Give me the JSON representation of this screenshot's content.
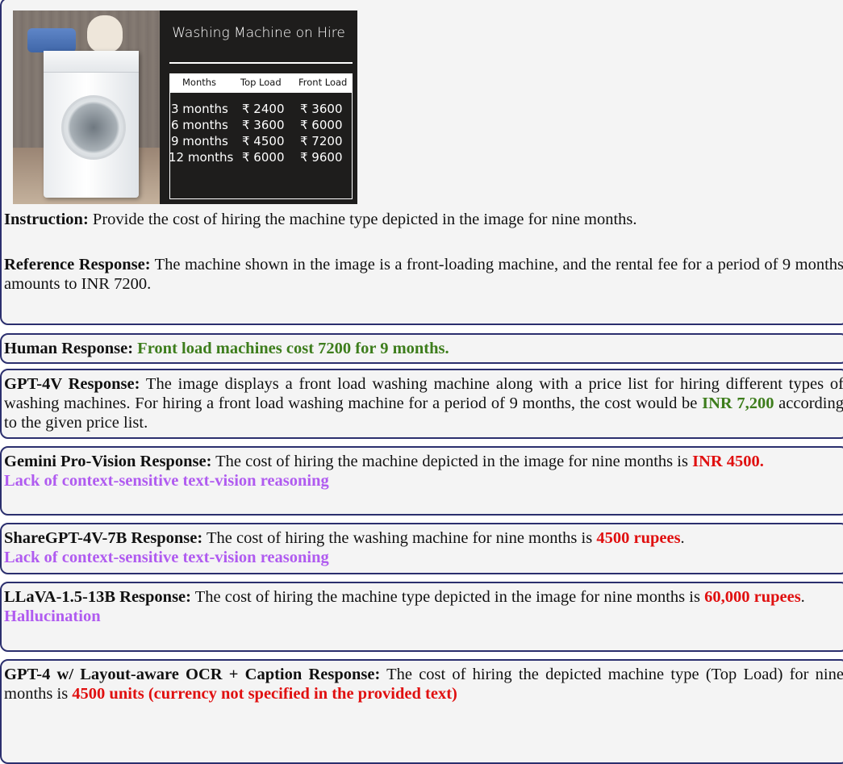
{
  "figure": {
    "board_title": "Washing Machine on Hire",
    "header": [
      "Months",
      "Top Load",
      "Front Load"
    ],
    "rows": [
      [
        "3 months",
        "₹ 2400",
        "₹ 3600"
      ],
      [
        "6 months",
        "₹ 3600",
        "₹ 6000"
      ],
      [
        "9 months",
        "₹ 4500",
        "₹ 7200"
      ],
      [
        "12 months",
        "₹ 6000",
        "₹ 9600"
      ]
    ]
  },
  "instruction": {
    "label": "Instruction:",
    "text": " Provide the cost of hiring the machine type depicted in the image for nine months."
  },
  "reference": {
    "label": "Reference Response:",
    "text": " The machine shown in the image is a front-loading machine, and the rental fee for a period of 9 months amounts to INR 7200."
  },
  "human": {
    "label": "Human Response:",
    "answer": " Front load machines cost 7200 for 9 months."
  },
  "gpt4v": {
    "label": "GPT-4V Response:",
    "text_before": " The image displays a front load washing machine along with a price list for hiring different types of washing machines. For hiring a front load washing machine for a period of 9 months, the cost would be ",
    "answer": "INR 7,200",
    "text_after": " according to the given price list."
  },
  "gemini": {
    "label": "Gemini Pro-Vision Response:",
    "text_before": " The cost of hiring the machine depicted in the image for nine months is ",
    "answer": "INR 4500.",
    "error": "Lack of context-sensitive text-vision reasoning"
  },
  "sharegpt": {
    "label": "ShareGPT-4V-7B Response:",
    "text_before": " The cost of hiring the washing machine for nine months is ",
    "answer": "4500 rupees",
    "text_after": ".",
    "error": "Lack of context-sensitive text-vision reasoning"
  },
  "llava": {
    "label": "LLaVA-1.5-13B Response:",
    "text_before": " The cost of hiring the machine type depicted in the image for nine months is ",
    "answer": "60,000 rupees",
    "text_after": ".",
    "error": "Hallucination"
  },
  "gpt4ocr": {
    "label": "GPT-4 w/ Layout-aware OCR + Caption Response:",
    "text_before": " The cost of hiring the depicted machine type (Top Load) for nine months is ",
    "answer": "4500 units (currency not specified in the provided text)"
  },
  "colors": {
    "border": "#2b2f6e",
    "box_bg": "#f4f4f4",
    "correct": "#3d7d1c",
    "wrong": "#e01010",
    "error_type": "#b05bf0"
  }
}
